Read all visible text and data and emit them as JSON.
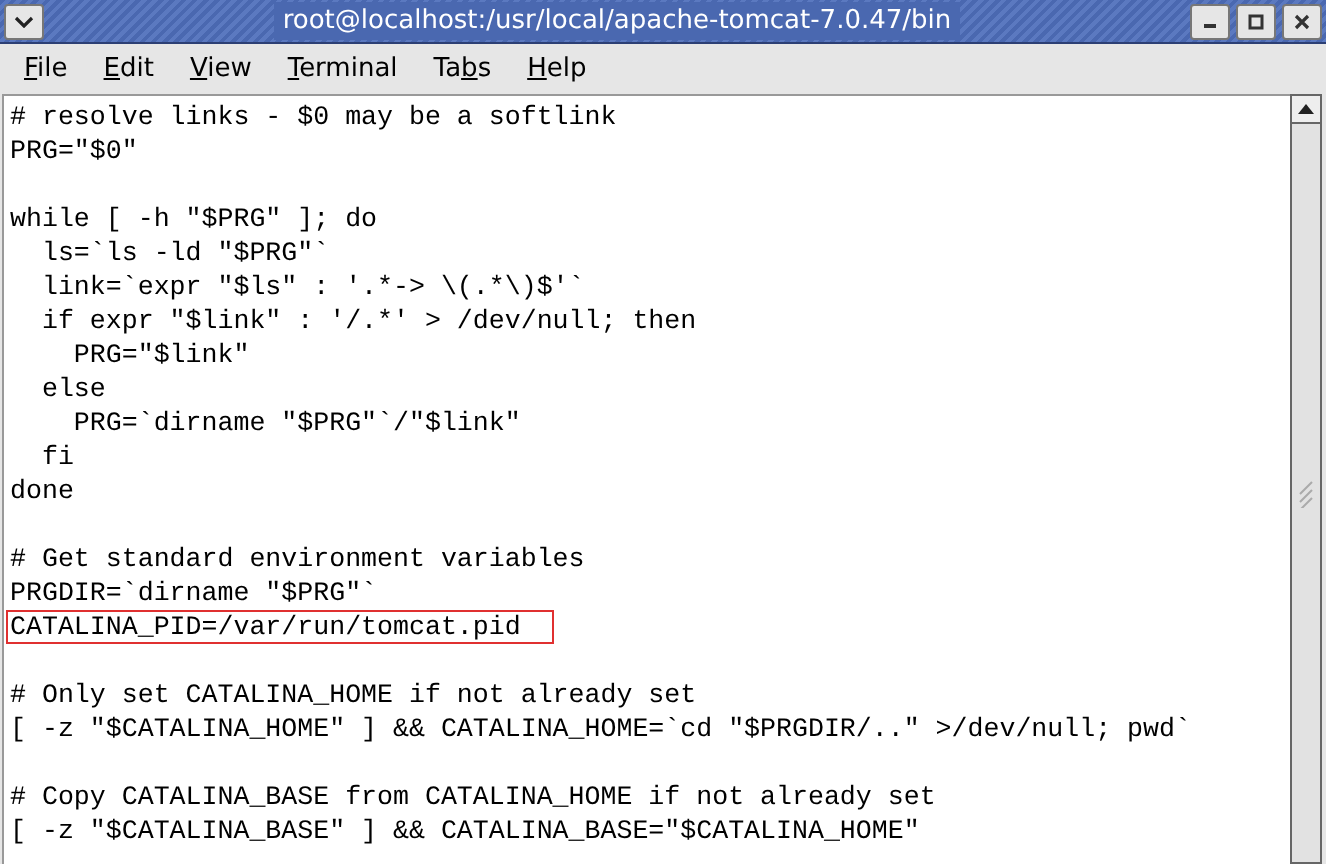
{
  "window": {
    "title": "root@localhost:/usr/local/apache-tomcat-7.0.47/bin"
  },
  "menu": [
    {
      "key": "F",
      "post": "ile"
    },
    {
      "key": "E",
      "post": "dit"
    },
    {
      "key": "V",
      "post": "iew"
    },
    {
      "key": "T",
      "post": "erminal"
    },
    {
      "pre": "Ta",
      "key": "b",
      "post": "s"
    },
    {
      "key": "H",
      "post": "elp"
    }
  ],
  "lines": [
    {
      "kind": "code",
      "text": "# resolve links - $0 may be a softlink"
    },
    {
      "kind": "code",
      "text": "PRG=\"$0\""
    },
    {
      "kind": "blank"
    },
    {
      "kind": "code",
      "text": "while [ -h \"$PRG\" ]; do"
    },
    {
      "kind": "code",
      "text": "  ls=`ls -ld \"$PRG\"`"
    },
    {
      "kind": "code",
      "text": "  link=`expr \"$ls\" : '.*-> \\(.*\\)$'`"
    },
    {
      "kind": "code",
      "text": "  if expr \"$link\" : '/.*' > /dev/null; then"
    },
    {
      "kind": "code",
      "text": "    PRG=\"$link\""
    },
    {
      "kind": "code",
      "text": "  else"
    },
    {
      "kind": "code",
      "text": "    PRG=`dirname \"$PRG\"`/\"$link\""
    },
    {
      "kind": "code",
      "text": "  fi"
    },
    {
      "kind": "code",
      "text": "done"
    },
    {
      "kind": "blank"
    },
    {
      "kind": "code",
      "text": "# Get standard environment variables"
    },
    {
      "kind": "code",
      "text": "PRGDIR=`dirname \"$PRG\"`"
    },
    {
      "kind": "boxed",
      "text": "CATALINA_PID=/var/run/tomcat.pid"
    },
    {
      "kind": "blank"
    },
    {
      "kind": "code",
      "text": "# Only set CATALINA_HOME if not already set"
    },
    {
      "kind": "code",
      "text": "[ -z \"$CATALINA_HOME\" ] && CATALINA_HOME=`cd \"$PRGDIR/..\" >/dev/null; pwd`"
    },
    {
      "kind": "blank"
    },
    {
      "kind": "code",
      "text": "# Copy CATALINA_BASE from CATALINA_HOME if not already set"
    },
    {
      "kind": "code",
      "text": "[ -z \"$CATALINA_BASE\" ] && CATALINA_BASE=\"$CATALINA_HOME\""
    }
  ]
}
